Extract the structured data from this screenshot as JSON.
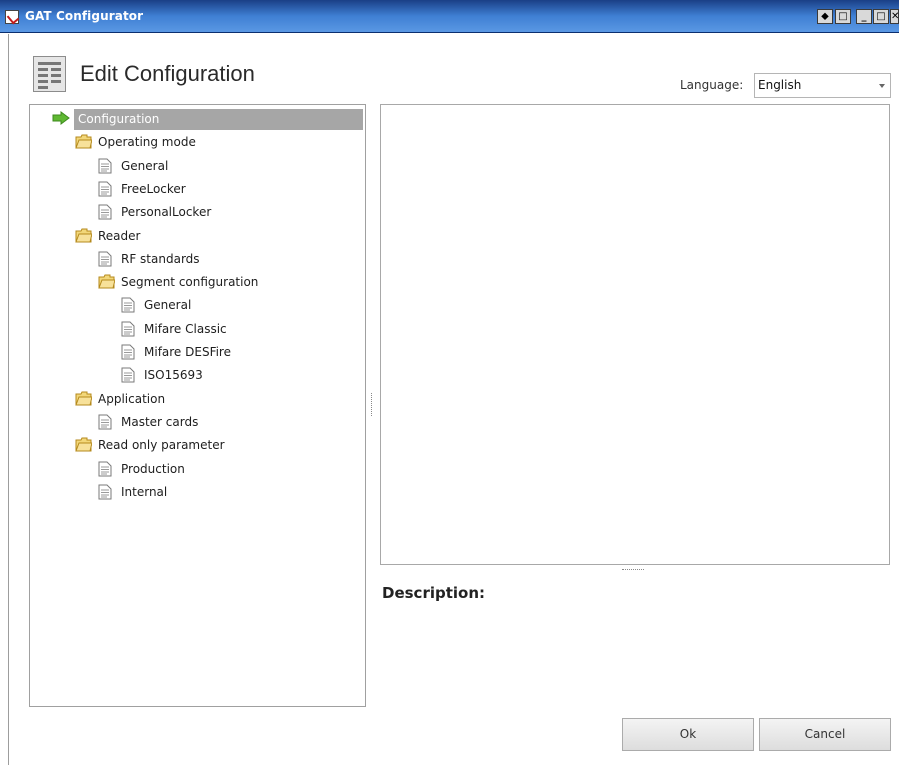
{
  "window": {
    "title": "GAT Configurator",
    "controls": [
      "⬥",
      "□",
      "_",
      "□",
      "✕"
    ]
  },
  "header": {
    "title": "Edit Configuration"
  },
  "language": {
    "label": "Language:",
    "selected": "English"
  },
  "tree": [
    {
      "label": "Configuration",
      "type": "root",
      "depth": 0,
      "selected": true
    },
    {
      "label": "Operating mode",
      "type": "folder",
      "depth": 1
    },
    {
      "label": "General",
      "type": "doc",
      "depth": 2
    },
    {
      "label": "FreeLocker",
      "type": "doc",
      "depth": 2
    },
    {
      "label": "PersonalLocker",
      "type": "doc",
      "depth": 2
    },
    {
      "label": "Reader",
      "type": "folder",
      "depth": 1
    },
    {
      "label": "RF standards",
      "type": "doc",
      "depth": 2
    },
    {
      "label": "Segment configuration",
      "type": "folder",
      "depth": 2
    },
    {
      "label": "General",
      "type": "doc",
      "depth": 3
    },
    {
      "label": "Mifare Classic",
      "type": "doc",
      "depth": 3
    },
    {
      "label": "Mifare DESFire",
      "type": "doc",
      "depth": 3
    },
    {
      "label": "ISO15693",
      "type": "doc",
      "depth": 3
    },
    {
      "label": "Application",
      "type": "folder",
      "depth": 1
    },
    {
      "label": "Master cards",
      "type": "doc",
      "depth": 2
    },
    {
      "label": "Read only parameter",
      "type": "folder",
      "depth": 1
    },
    {
      "label": "Production",
      "type": "doc",
      "depth": 2
    },
    {
      "label": "Internal",
      "type": "doc",
      "depth": 2
    }
  ],
  "description": {
    "label": "Description:"
  },
  "buttons": {
    "ok": "Ok",
    "cancel": "Cancel"
  },
  "colors": {
    "titlebar": "#3f7fd3",
    "selection": "#a6a6a6",
    "folder": "#f2c94c",
    "arrow": "#5fb832"
  }
}
